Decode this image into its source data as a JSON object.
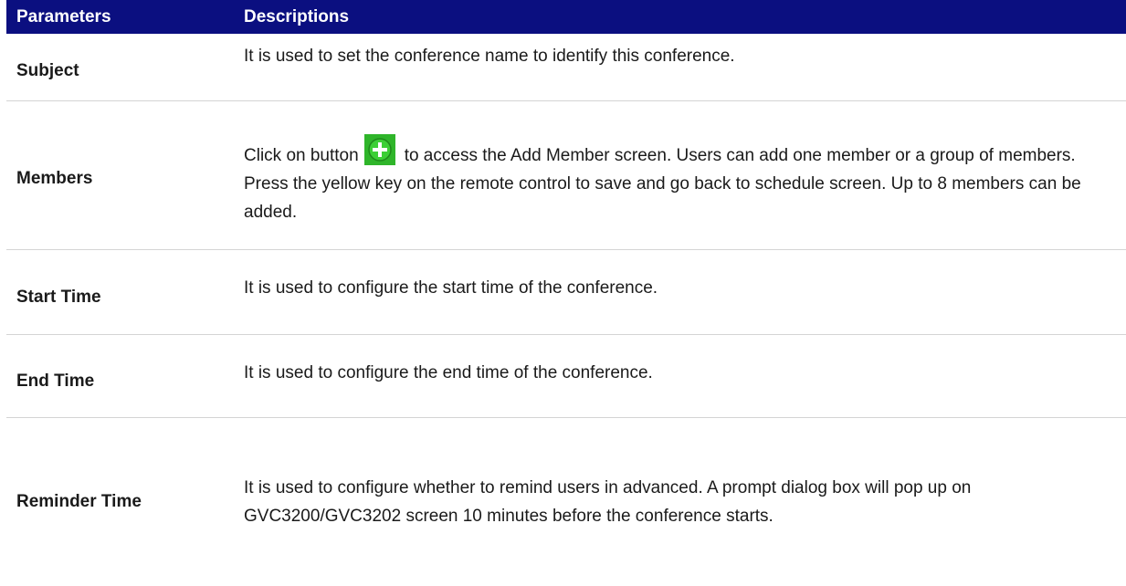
{
  "table": {
    "headers": [
      "Parameters",
      "Descriptions"
    ],
    "rows": [
      {
        "name": "Subject",
        "desc": "It is used to set the conference name to identify this conference."
      },
      {
        "name": "Members",
        "desc_before": "Click on button",
        "desc_after": "to access the Add Member screen. Users can add one member or a group of members. Press the yellow key on the remote control to save and go back to schedule screen. Up to 8 members can be added."
      },
      {
        "name": "Start Time",
        "desc": "It is used to configure the start time of the conference."
      },
      {
        "name": "End Time",
        "desc": "It is used to configure the end time of the conference."
      },
      {
        "name": "Reminder Time",
        "desc": "It is used to configure whether to remind users in advanced. A prompt dialog box will pop up on GVC3200/GVC3202 screen 10 minutes before the conference starts."
      }
    ]
  },
  "colors": {
    "header_bg": "#0b0f80",
    "header_text": "#ffffff",
    "add_button": "#2fb52a"
  },
  "icons": {
    "add_member": "plus-circle-icon"
  }
}
